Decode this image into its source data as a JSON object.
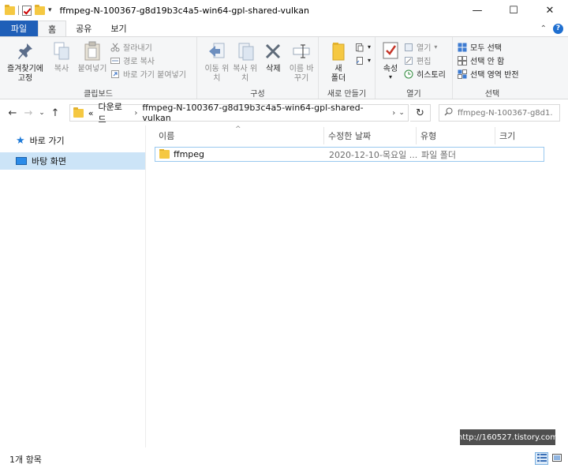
{
  "window": {
    "title": "ffmpeg-N-100367-g8d19b3c4a5-win64-gpl-shared-vulkan",
    "minimize": "—",
    "maximize": "☐",
    "close": "✕"
  },
  "tabs": {
    "file": "파일",
    "home": "홈",
    "share": "공유",
    "view": "보기"
  },
  "ribbon": {
    "clipboard": {
      "label": "클립보드",
      "pin": "즐겨찾기에 고정",
      "copy": "복사",
      "paste": "붙여넣기",
      "cut": "잘라내기",
      "copy_path": "경로 복사",
      "paste_shortcut": "바로 가기 붙여넣기"
    },
    "organize": {
      "label": "구성",
      "move_to": "이동 위치",
      "copy_to": "복사 위치",
      "delete": "삭제",
      "rename": "이름 바꾸기"
    },
    "new": {
      "label": "새로 만들기",
      "new_folder": "새 폴더"
    },
    "open": {
      "label": "열기",
      "properties": "속성",
      "open": "열기",
      "edit": "편집",
      "history": "히스토리"
    },
    "select": {
      "label": "선택",
      "select_all": "모두 선택",
      "select_none": "선택 안 함",
      "invert": "선택 영역 반전"
    }
  },
  "address": {
    "overflow": "«",
    "crumbs": [
      "다운로드",
      "ffmpeg-N-100367-g8d19b3c4a5-win64-gpl-shared-vulkan"
    ],
    "sep": "›"
  },
  "search": {
    "placeholder": "ffmpeg-N-100367-g8d1..."
  },
  "navpane": {
    "quick_access": "바로 가기",
    "desktop": "바탕 화면"
  },
  "columns": {
    "name": "이름",
    "date": "수정한 날짜",
    "type": "유형",
    "size": "크기"
  },
  "files": [
    {
      "name": "ffmpeg",
      "date": "2020-12-10-목요일 ...",
      "type": "파일 폴더",
      "size": ""
    }
  ],
  "status": {
    "count": "1개 항목"
  },
  "watermark": "http://160527.tistory.com",
  "colors": {
    "accent": "#1f5fb8",
    "selection": "#cce4f7",
    "folder": "#f5c842"
  }
}
